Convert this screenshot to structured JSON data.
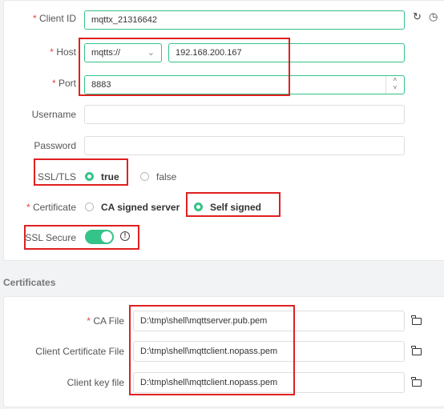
{
  "connection": {
    "client_id": {
      "label": "Client ID",
      "value": "mqttx_21316642"
    },
    "host": {
      "label": "Host",
      "protocol": "mqtts://",
      "value": "192.168.200.167"
    },
    "port": {
      "label": "Port",
      "value": "8883"
    },
    "username": {
      "label": "Username",
      "value": ""
    },
    "password": {
      "label": "Password",
      "value": ""
    },
    "ssl_tls": {
      "label": "SSL/TLS",
      "options": [
        "true",
        "false"
      ],
      "selected": "true"
    },
    "certificate": {
      "label": "Certificate",
      "options": [
        "CA signed server",
        "Self signed"
      ],
      "selected": "Self signed"
    },
    "ssl_secure": {
      "label": "SSL Secure",
      "enabled": true
    }
  },
  "certificates": {
    "title": "Certificates",
    "ca_file": {
      "label": "CA File",
      "value": "D:\\tmp\\shell\\mqttserver.pub.pem"
    },
    "client_cert": {
      "label": "Client Certificate File",
      "value": "D:\\tmp\\shell\\mqttclient.nopass.pem"
    },
    "client_key": {
      "label": "Client key file",
      "value": "D:\\tmp\\shell\\mqttclient.nopass.pem"
    }
  },
  "icons": {
    "refresh": "refresh-icon",
    "history": "clock-icon",
    "info": "info-icon",
    "folder": "folder-icon"
  },
  "colors": {
    "accent": "#34c388",
    "required": "#e54545",
    "highlight": "#e02020"
  }
}
